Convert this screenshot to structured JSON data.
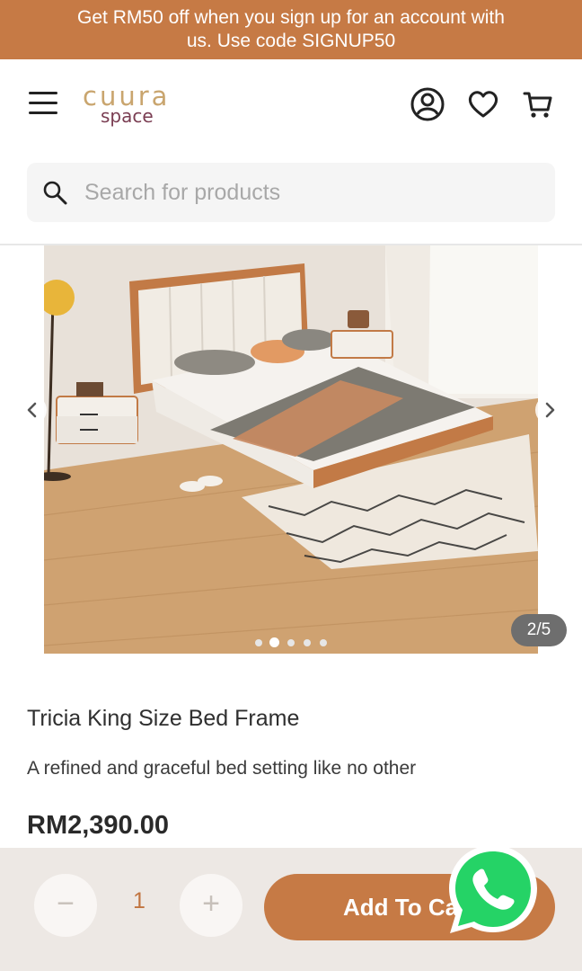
{
  "promo": {
    "line1": "Get RM50 off when you sign up for an account with",
    "line2": "us. Use code SIGNUP50"
  },
  "header": {
    "logo_top": "cuura",
    "logo_bottom": "space",
    "icons": [
      "menu-icon",
      "account-icon",
      "wishlist-heart-icon",
      "cart-icon"
    ]
  },
  "search": {
    "placeholder": "Search for products",
    "value": ""
  },
  "gallery": {
    "counter": "2/5",
    "current_index": 2,
    "total": 5
  },
  "product": {
    "title": "Tricia King Size Bed Frame",
    "subtitle": "A refined and graceful bed setting like no other",
    "price": "RM2,390.00"
  },
  "cart": {
    "minus": "−",
    "quantity": "1",
    "plus": "+",
    "add_label": "Add To Cart"
  },
  "colors": {
    "brand": "#c67a45",
    "bottom_bar": "#ede8e4",
    "whatsapp": "#25d366"
  }
}
